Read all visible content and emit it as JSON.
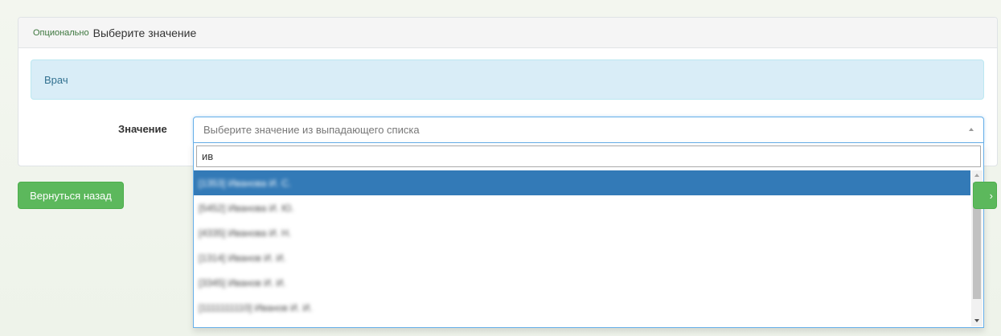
{
  "panel": {
    "optional_tag": "Опционально",
    "title": "Выберите значение"
  },
  "info_box": {
    "text": "Врач"
  },
  "field": {
    "label": "Значение",
    "placeholder": "Выберите значение из выпадающего списка",
    "search_value": "ив"
  },
  "dropdown": {
    "results": [
      "[1353] Иванова И. С.",
      "[5452] Иванова И. Ю.",
      "[4335] Иванова И. Н.",
      "[1314] Иванов И. И.",
      "[3345] Иванов И. И.",
      "[1111111110] Иванов И. И."
    ],
    "highlighted_index": 0
  },
  "buttons": {
    "back_label": "Вернуться назад",
    "next_label": "›"
  },
  "colors": {
    "accent_blue": "#337ab7",
    "success_green": "#5cb85c",
    "info_bg": "#d9edf7",
    "info_text": "#31708f",
    "optional_text": "#3c763d"
  }
}
